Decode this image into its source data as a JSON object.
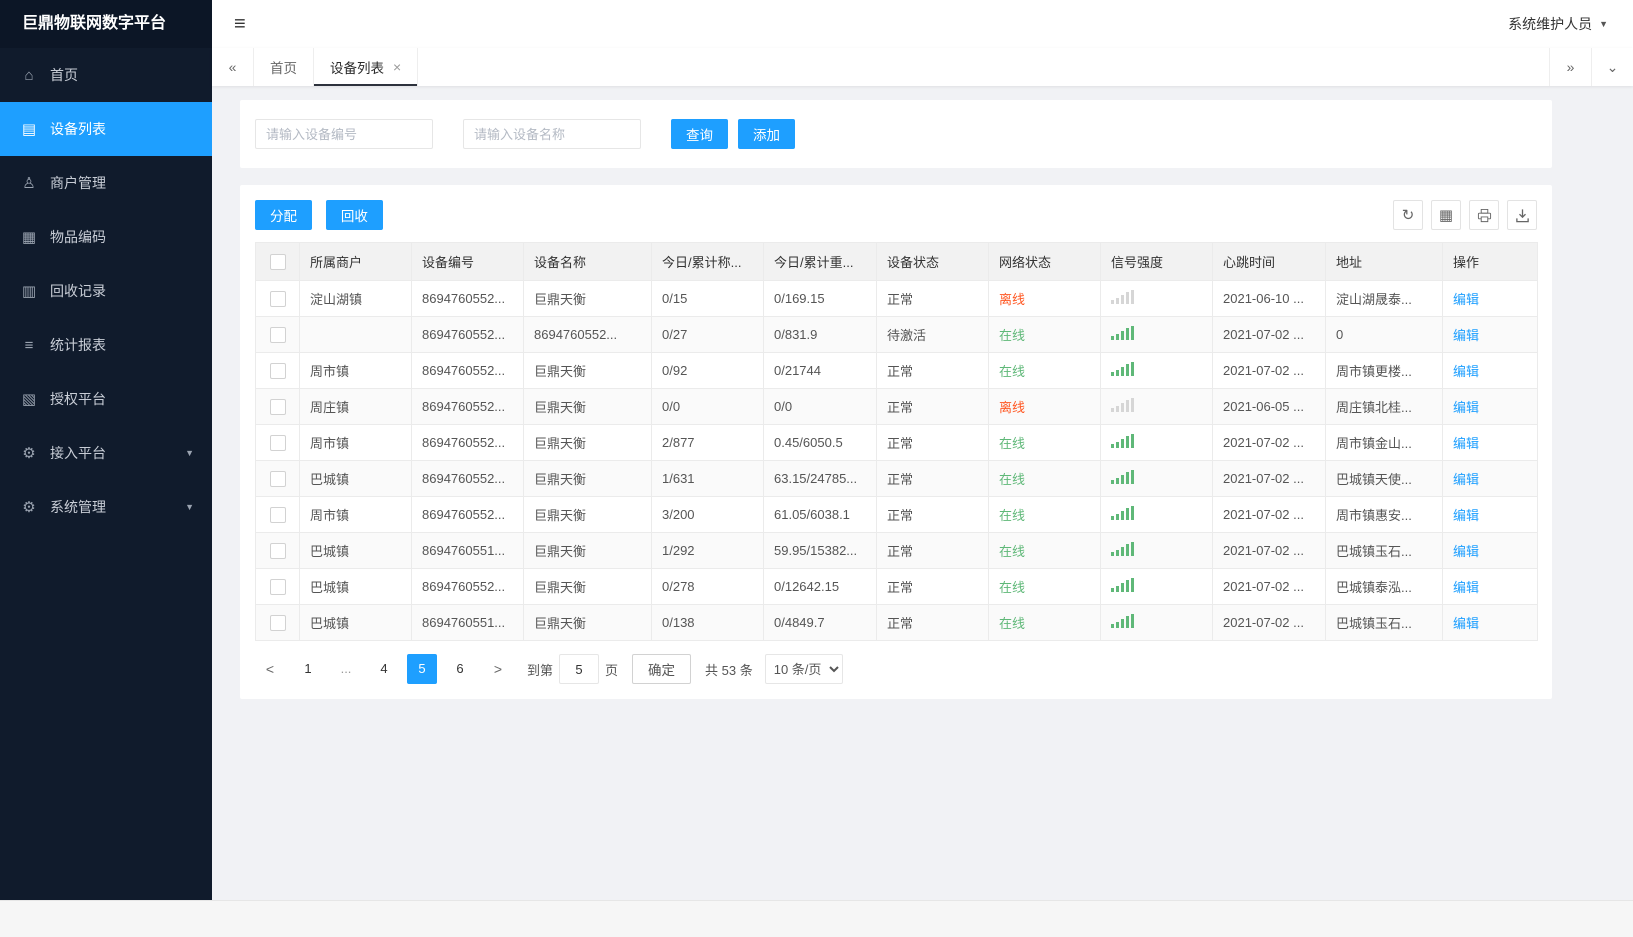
{
  "app": {
    "title": "巨鼎物联网数字平台",
    "user": "系统维护人员"
  },
  "colors": {
    "accent": "#1E9FFF",
    "online": "#5FB878",
    "offline": "#FF5722",
    "sidebar": "#101b2c"
  },
  "sidebar": {
    "items": [
      {
        "id": "home",
        "icon": "home",
        "label": "首页"
      },
      {
        "id": "device-list",
        "icon": "list",
        "label": "设备列表",
        "active": true
      },
      {
        "id": "merchant-mgmt",
        "icon": "user",
        "label": "商户管理"
      },
      {
        "id": "item-code",
        "icon": "grid",
        "label": "物品编码"
      },
      {
        "id": "recycle-record",
        "icon": "doc",
        "label": "回收记录"
      },
      {
        "id": "stats-report",
        "icon": "lines",
        "label": "统计报表"
      },
      {
        "id": "auth-platform",
        "icon": "panel",
        "label": "授权平台"
      },
      {
        "id": "access-platform",
        "icon": "gear",
        "label": "接入平台",
        "expandable": true
      },
      {
        "id": "system-mgmt",
        "icon": "gear",
        "label": "系统管理",
        "expandable": true
      }
    ]
  },
  "tabs": {
    "items": [
      {
        "label": "首页"
      },
      {
        "label": "设备列表",
        "active": true,
        "closable": true
      }
    ]
  },
  "search": {
    "device_no_placeholder": "请输入设备编号",
    "device_name_placeholder": "请输入设备名称",
    "query_label": "查询",
    "add_label": "添加"
  },
  "toolbar": {
    "assign_label": "分配",
    "recycle_label": "回收"
  },
  "table": {
    "columns": [
      "所属商户",
      "设备编号",
      "设备名称",
      "今日/累计称...",
      "今日/累计重...",
      "设备状态",
      "网络状态",
      "信号强度",
      "心跳时间",
      "地址",
      "操作"
    ],
    "edit_label": "编辑",
    "rows": [
      {
        "merchant": "淀山湖镇",
        "device_no": "8694760552...",
        "device_name": "巨鼎天衡",
        "today_count": "0/15",
        "today_weight": "0/169.15",
        "device_status": "正常",
        "network_status": "离线",
        "online": false,
        "heartbeat": "2021-06-10 ...",
        "address": "淀山湖晟泰..."
      },
      {
        "merchant": "",
        "device_no": "8694760552...",
        "device_name": "8694760552...",
        "today_count": "0/27",
        "today_weight": "0/831.9",
        "device_status": "待激活",
        "network_status": "在线",
        "online": true,
        "heartbeat": "2021-07-02 ...",
        "address": "0"
      },
      {
        "merchant": "周市镇",
        "device_no": "8694760552...",
        "device_name": "巨鼎天衡",
        "today_count": "0/92",
        "today_weight": "0/21744",
        "device_status": "正常",
        "network_status": "在线",
        "online": true,
        "heartbeat": "2021-07-02 ...",
        "address": "周市镇更楼..."
      },
      {
        "merchant": "周庄镇",
        "device_no": "8694760552...",
        "device_name": "巨鼎天衡",
        "today_count": "0/0",
        "today_weight": "0/0",
        "device_status": "正常",
        "network_status": "离线",
        "online": false,
        "heartbeat": "2021-06-05 ...",
        "address": "周庄镇北桂..."
      },
      {
        "merchant": "周市镇",
        "device_no": "8694760552...",
        "device_name": "巨鼎天衡",
        "today_count": "2/877",
        "today_weight": "0.45/6050.5",
        "device_status": "正常",
        "network_status": "在线",
        "online": true,
        "heartbeat": "2021-07-02 ...",
        "address": "周市镇金山..."
      },
      {
        "merchant": "巴城镇",
        "device_no": "8694760552...",
        "device_name": "巨鼎天衡",
        "today_count": "1/631",
        "today_weight": "63.15/24785...",
        "device_status": "正常",
        "network_status": "在线",
        "online": true,
        "heartbeat": "2021-07-02 ...",
        "address": "巴城镇天使..."
      },
      {
        "merchant": "周市镇",
        "device_no": "8694760552...",
        "device_name": "巨鼎天衡",
        "today_count": "3/200",
        "today_weight": "61.05/6038.1",
        "device_status": "正常",
        "network_status": "在线",
        "online": true,
        "heartbeat": "2021-07-02 ...",
        "address": "周市镇惠安..."
      },
      {
        "merchant": "巴城镇",
        "device_no": "8694760551...",
        "device_name": "巨鼎天衡",
        "today_count": "1/292",
        "today_weight": "59.95/15382...",
        "device_status": "正常",
        "network_status": "在线",
        "online": true,
        "heartbeat": "2021-07-02 ...",
        "address": "巴城镇玉石..."
      },
      {
        "merchant": "巴城镇",
        "device_no": "8694760552...",
        "device_name": "巨鼎天衡",
        "today_count": "0/278",
        "today_weight": "0/12642.15",
        "device_status": "正常",
        "network_status": "在线",
        "online": true,
        "heartbeat": "2021-07-02 ...",
        "address": "巴城镇泰泓..."
      },
      {
        "merchant": "巴城镇",
        "device_no": "8694760551...",
        "device_name": "巨鼎天衡",
        "today_count": "0/138",
        "today_weight": "0/4849.7",
        "device_status": "正常",
        "network_status": "在线",
        "online": true,
        "heartbeat": "2021-07-02 ...",
        "address": "巴城镇玉石..."
      }
    ]
  },
  "pagination": {
    "pages": [
      {
        "label": "1"
      },
      {
        "label": "..."
      },
      {
        "label": "4"
      },
      {
        "label": "5",
        "active": true
      },
      {
        "label": "6"
      }
    ],
    "goto_label": "到第",
    "goto_value": "5",
    "page_label": "页",
    "confirm_label": "确定",
    "total_label": "共 53 条",
    "page_size_label": "10 条/页"
  }
}
